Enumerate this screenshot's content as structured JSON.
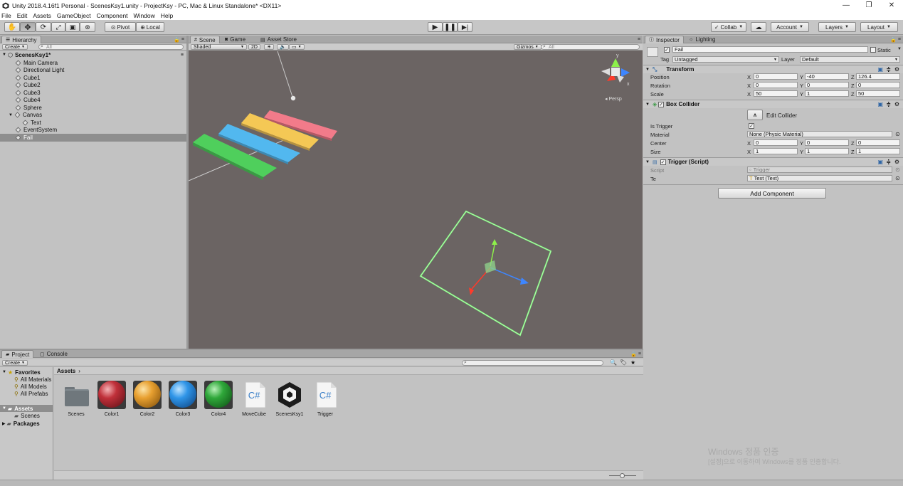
{
  "window": {
    "title": "Unity 2018.4.16f1 Personal - ScenesKsy1.unity - ProjectKsy - PC, Mac & Linux Standalone* <DX11>",
    "minimize": "—",
    "restore": "❐",
    "close": "✕"
  },
  "menu": [
    "File",
    "Edit",
    "Assets",
    "GameObject",
    "Component",
    "Window",
    "Help"
  ],
  "toolbar": {
    "pivot": "Pivot",
    "local": "Local",
    "collab": "Collab",
    "account": "Account",
    "layers": "Layers",
    "layout": "Layout"
  },
  "hierarchy": {
    "tab": "Hierarchy",
    "create": "Create",
    "search_placeholder": "All",
    "scene": "ScenesKsy1*",
    "items": [
      "Main Camera",
      "Directional Light",
      "Cube1",
      "Cube2",
      "Cube3",
      "Cube4",
      "Sphere",
      "Canvas",
      "Text",
      "EventSystem",
      "Fail"
    ]
  },
  "scene": {
    "tabs": [
      "Scene",
      "Game",
      "Asset Store"
    ],
    "shading": "Shaded",
    "mode2d": "2D",
    "gizmos": "Gizmos",
    "search_placeholder": "All",
    "persp": "Persp",
    "axes": {
      "x": "x",
      "y": "y"
    },
    "colors": {
      "red": "#f27b8a",
      "yellow": "#f4c855",
      "blue": "#52b8ef",
      "green": "#4fcf5c",
      "ground": "#6b6463"
    }
  },
  "inspector": {
    "tabs": [
      "Inspector",
      "Lighting"
    ],
    "object_name": "Fail",
    "static_label": "Static",
    "tag_label": "Tag",
    "tag_value": "Untagged",
    "layer_label": "Layer",
    "layer_value": "Default",
    "transform": {
      "title": "Transform",
      "position_label": "Position",
      "rotation_label": "Rotation",
      "scale_label": "Scale",
      "position": {
        "x": "0",
        "y": "-40",
        "z": "126.4"
      },
      "rotation": {
        "x": "0",
        "y": "0",
        "z": "0"
      },
      "scale": {
        "x": "50",
        "y": "1",
        "z": "50"
      }
    },
    "box_collider": {
      "title": "Box Collider",
      "edit": "Edit Collider",
      "is_trigger_label": "Is Trigger",
      "material_label": "Material",
      "material_value": "None (Physic Material)",
      "center_label": "Center",
      "size_label": "Size",
      "center": {
        "x": "0",
        "y": "0",
        "z": "0"
      },
      "size": {
        "x": "1",
        "y": "1",
        "z": "1"
      }
    },
    "trigger_script": {
      "title": "Trigger (Script)",
      "script_label": "Script",
      "script_value": "Trigger",
      "te_label": "Te",
      "te_value": "Text (Text)"
    },
    "add_component": "Add Component",
    "axis_x": "X",
    "axis_y": "Y",
    "axis_z": "Z"
  },
  "project": {
    "tabs": [
      "Project",
      "Console"
    ],
    "create": "Create",
    "favorites": "Favorites",
    "favorite_items": [
      "All Materials",
      "All Models",
      "All Prefabs"
    ],
    "assets_root": "Assets",
    "assets_children": [
      "Scenes"
    ],
    "packages": "Packages",
    "breadcrumb": "Assets",
    "assets": [
      {
        "name": "Scenes",
        "kind": "folder"
      },
      {
        "name": "Color1",
        "kind": "material",
        "color": "#c0303a"
      },
      {
        "name": "Color2",
        "kind": "material",
        "color": "#e8a030"
      },
      {
        "name": "Color3",
        "kind": "material",
        "color": "#2f95e8"
      },
      {
        "name": "Color4",
        "kind": "material",
        "color": "#2fa83a"
      },
      {
        "name": "MoveCube",
        "kind": "script"
      },
      {
        "name": "ScenesKsy1",
        "kind": "scene"
      },
      {
        "name": "Trigger",
        "kind": "script"
      }
    ],
    "cs_label": "C#"
  },
  "watermark": {
    "line1": "Windows 정품 인증",
    "line2": "[설정]으로 이동하여 Windows를 정품 인증합니다."
  }
}
